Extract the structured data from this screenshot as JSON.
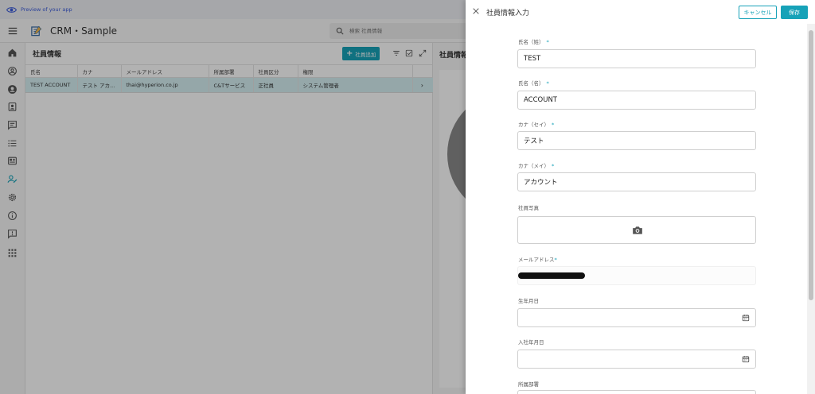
{
  "preview_bar": {
    "text": "Preview of your app"
  },
  "header": {
    "app_title": "CRM・Sample",
    "search_placeholder": "検索 社員情報"
  },
  "sidebar": {
    "icons": [
      "home-icon",
      "person-circle-icon",
      "account-icon",
      "contact-card-icon",
      "message-icon",
      "list-icon",
      "newspaper-icon",
      "employee-icon",
      "settings-icon",
      "info-icon",
      "feedback-icon",
      "apps-grid-icon"
    ],
    "active": "employee-icon"
  },
  "list": {
    "title": "社員情報",
    "add_button": "社員追加",
    "columns": [
      "氏名",
      "カナ",
      "メールアドレス",
      "所属部署",
      "社員区分",
      "権限"
    ],
    "rows": [
      {
        "name": "TEST ACCOUNT",
        "kana": "テスト アカ...",
        "email": "thai@hyperion.co.jp",
        "dept": "C&Tサービス",
        "type": "正社員",
        "role": "システム管理者"
      }
    ]
  },
  "detail": {
    "title": "社員情報"
  },
  "drawer": {
    "title": "社員情報入力",
    "cancel": "キャンセル",
    "save": "保存",
    "required_mark": "*",
    "fields": {
      "last_name": {
        "label": "氏名（姓）",
        "value": "TEST"
      },
      "first_name": {
        "label": "氏名（名）",
        "value": "ACCOUNT"
      },
      "kana_last": {
        "label": "カナ（セイ）",
        "value": "テスト"
      },
      "kana_first": {
        "label": "カナ（メイ）",
        "value": "アカウント"
      },
      "photo": {
        "label": "社員写真"
      },
      "email": {
        "label": "メールアドレス"
      },
      "birth_date": {
        "label": "生年月日",
        "value": ""
      },
      "hire_date": {
        "label": "入社年月日",
        "value": ""
      },
      "department": {
        "label": "所属部署"
      }
    }
  },
  "colors": {
    "accent": "#17a2b8",
    "selected_row": "#d6eff2"
  }
}
